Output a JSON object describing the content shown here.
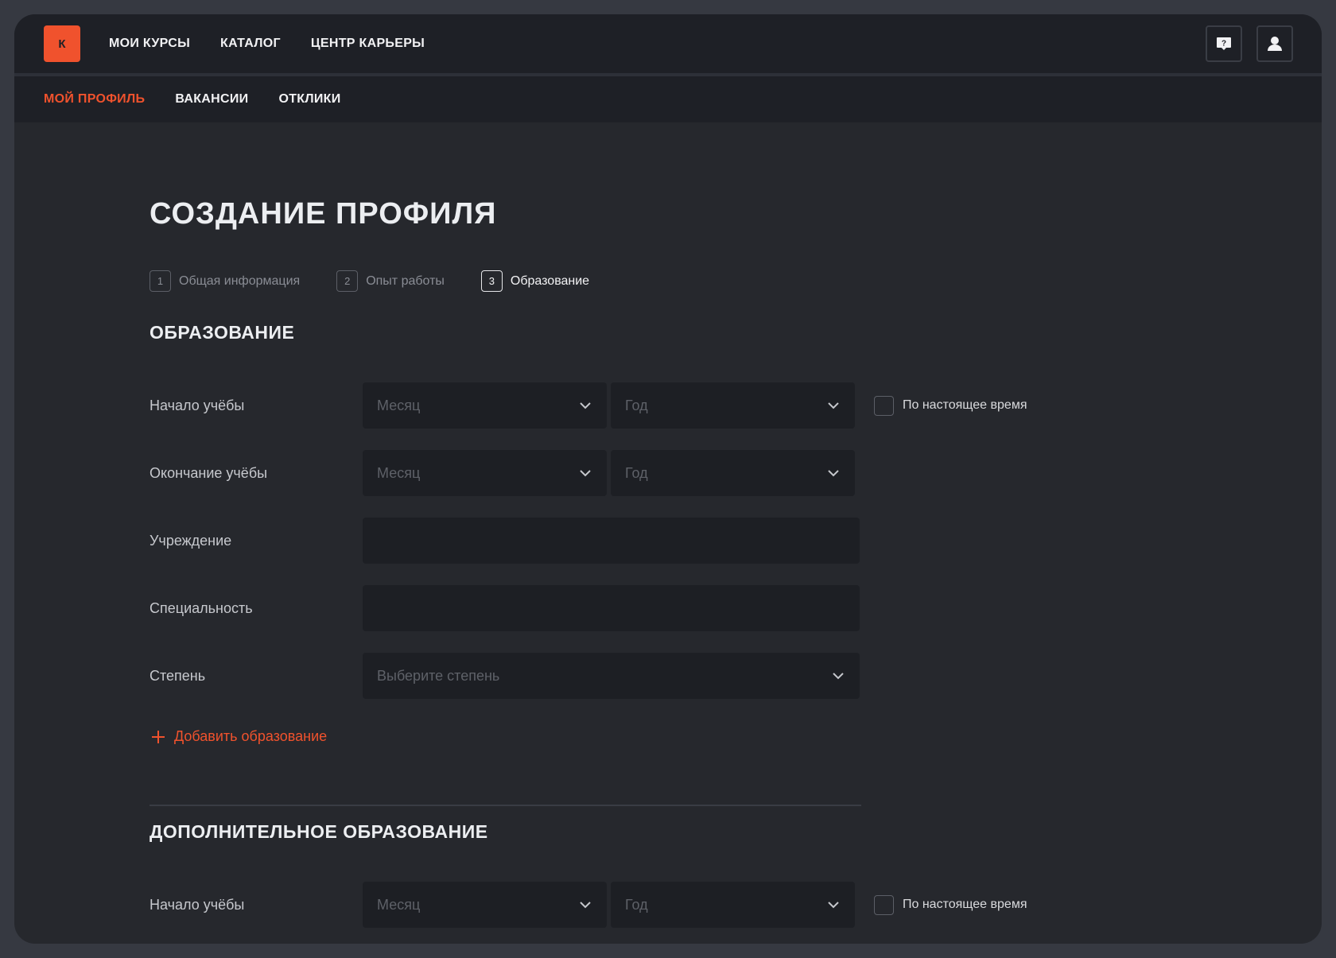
{
  "logo": {
    "letter": "К"
  },
  "topnav": {
    "items": [
      "МОИ КУРСЫ",
      "КАТАЛОГ",
      "ЦЕНТР КАРЬЕРЫ"
    ]
  },
  "subnav": {
    "items": [
      "МОЙ ПРОФИЛЬ",
      "ВАКАНСИИ",
      "ОТКЛИКИ"
    ],
    "active": "МОЙ ПРОФИЛЬ"
  },
  "page": {
    "title": "СОЗДАНИЕ ПРОФИЛЯ"
  },
  "steps": [
    {
      "num": "1",
      "label": "Общая информация"
    },
    {
      "num": "2",
      "label": "Опыт работы"
    },
    {
      "num": "3",
      "label": "Образование"
    }
  ],
  "education": {
    "title": "ОБРАЗОВАНИЕ",
    "start_label": "Начало учёбы",
    "end_label": "Окончание учёбы",
    "institution_label": "Учреждение",
    "specialty_label": "Специальность",
    "degree_label": "Степень",
    "month_placeholder": "Месяц",
    "year_placeholder": "Год",
    "degree_placeholder": "Выберите степень",
    "present_label": "По настоящее время",
    "add_label": "Добавить образование"
  },
  "additional": {
    "title": "ДОПОЛНИТЕЛЬНОЕ ОБРАЗОВАНИЕ",
    "start_label": "Начало учёбы",
    "month_placeholder": "Месяц",
    "year_placeholder": "Год",
    "present_label": "По настоящее время"
  },
  "colors": {
    "accent": "#f0522d",
    "background": "#26282d",
    "nav": "#1e2026"
  }
}
